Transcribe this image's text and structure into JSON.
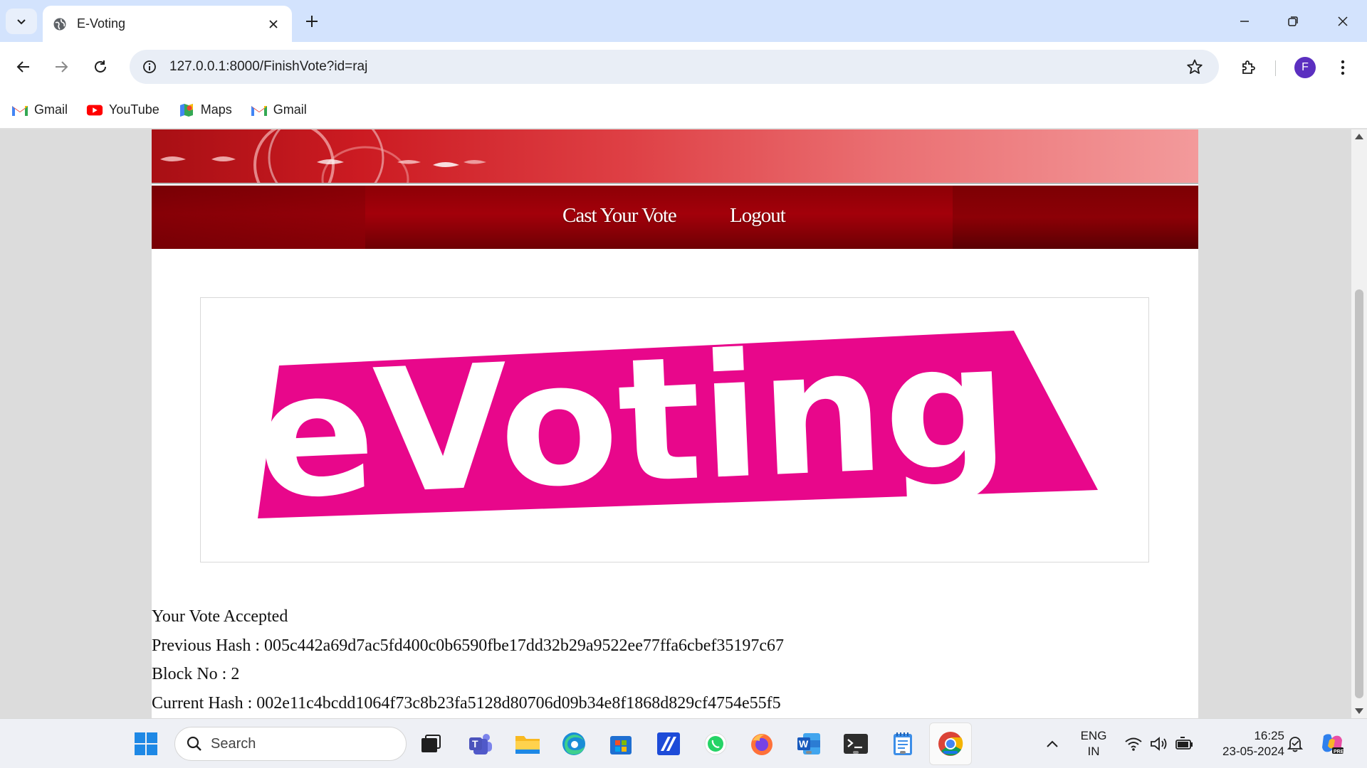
{
  "browser": {
    "tab_title": "E-Voting",
    "url": "127.0.0.1:8000/FinishVote?id=raj",
    "profile_initial": "F",
    "bookmarks": [
      {
        "label": "Gmail",
        "icon": "gmail-icon"
      },
      {
        "label": "YouTube",
        "icon": "youtube-icon"
      },
      {
        "label": "Maps",
        "icon": "maps-icon"
      },
      {
        "label": "Gmail",
        "icon": "gmail-icon"
      }
    ]
  },
  "page": {
    "nav": {
      "cast_vote": "Cast Your Vote",
      "logout": "Logout"
    },
    "logo_text": "eVoting",
    "result": {
      "status": "Your Vote Accepted",
      "previous_hash": "Previous Hash : 005c442a69d7ac5fd400c0b6590fbe17dd32b29a9522ee77ffa6cbef35197c67",
      "block_no": "Block No : 2",
      "current_hash": "Current Hash : 002e11c4bcdd1064f73c8b23fa5128d80706d09b34e8f1868d829cf4754e55f5"
    }
  },
  "taskbar": {
    "search_placeholder": "Search",
    "language_line1": "ENG",
    "language_line2": "IN",
    "time": "16:25",
    "date": "23-05-2024"
  },
  "colors": {
    "logo_pink": "#e8078b",
    "nav_red": "#a3000a",
    "banner_red": "#cc1b22"
  }
}
